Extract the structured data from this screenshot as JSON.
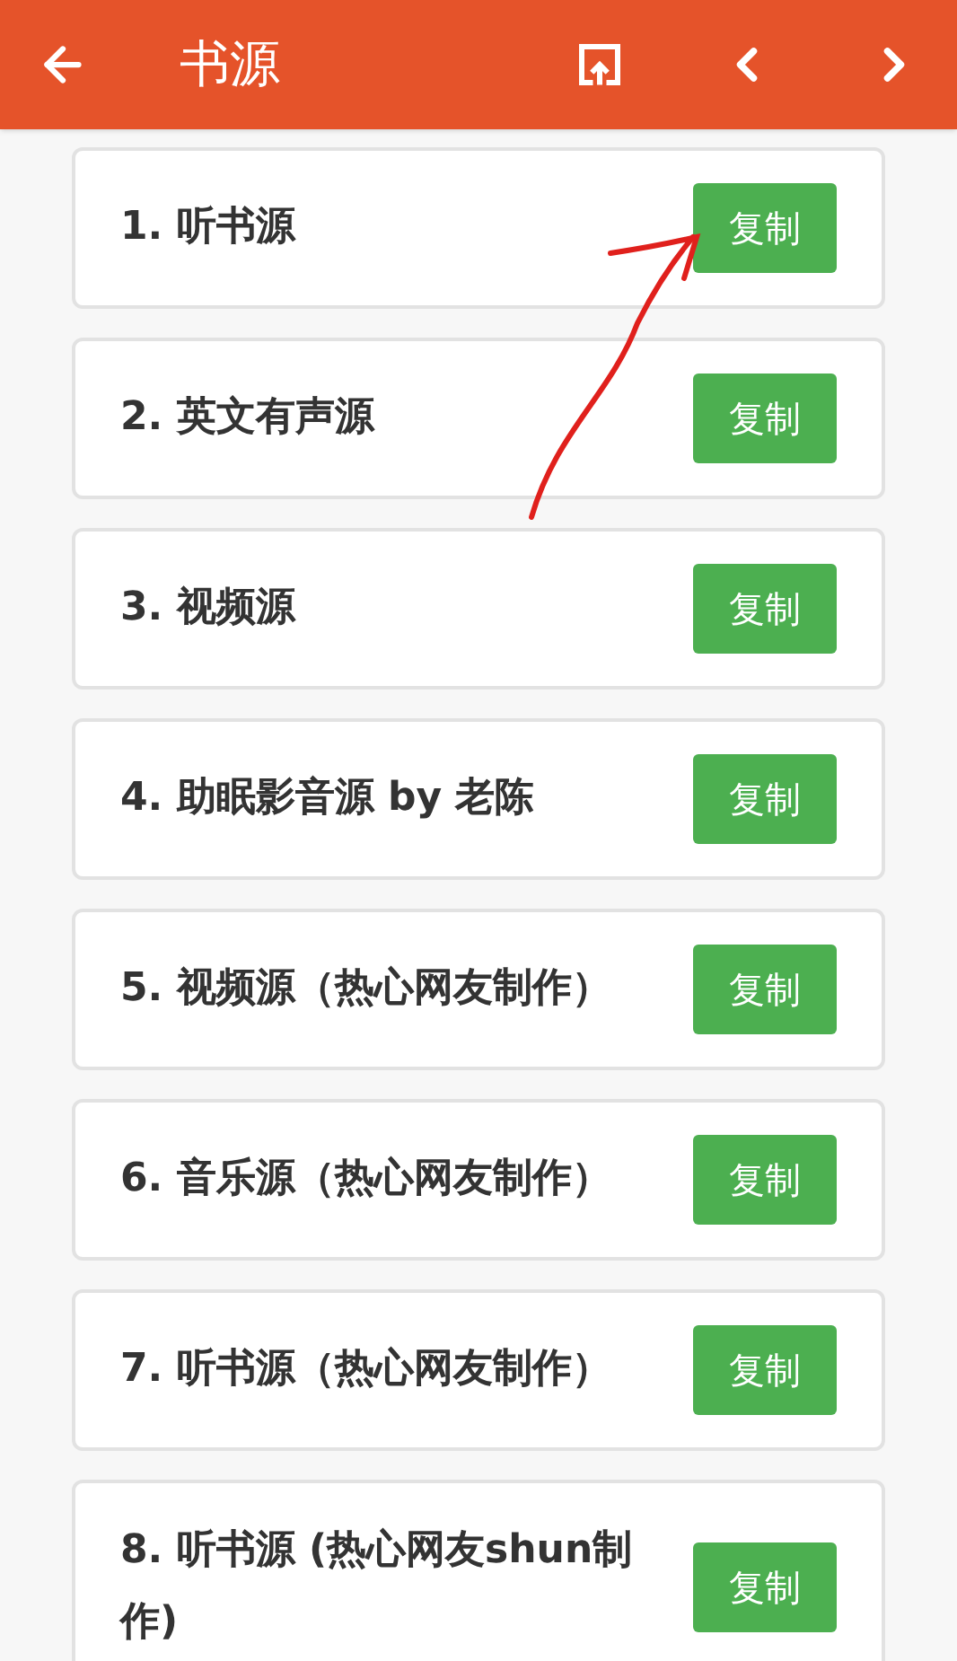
{
  "header": {
    "title": "书源"
  },
  "sources": [
    {
      "label": "1. 听书源",
      "button": "复制"
    },
    {
      "label": "2. 英文有声源",
      "button": "复制"
    },
    {
      "label": "3. 视频源",
      "button": "复制"
    },
    {
      "label": "4. 助眠影音源 by 老陈",
      "button": "复制"
    },
    {
      "label": "5. 视频源（热心网友制作）",
      "button": "复制"
    },
    {
      "label": "6. 音乐源（热心网友制作）",
      "button": "复制"
    },
    {
      "label": "7. 听书源（热心网友制作）",
      "button": "复制"
    },
    {
      "label": "8. 听书源 (热心网友shun制作)",
      "button": "复制"
    }
  ]
}
